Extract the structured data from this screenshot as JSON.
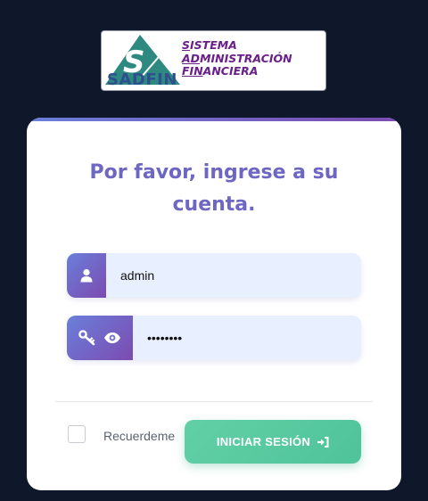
{
  "logo": {
    "name": "SADFIN",
    "lines": [
      {
        "first": "S",
        "rest": "ISTEMA"
      },
      {
        "first": "AD",
        "rest": "MINISTRACIÓN"
      },
      {
        "first": "FIN",
        "rest": "ANCIERA"
      }
    ],
    "colors": {
      "triangle": "#2e8a80",
      "text": "#6a1f8a",
      "name": "#2f4f8f"
    }
  },
  "login": {
    "title_line1": "Por favor, ingrese a su",
    "title_line2": "cuenta.",
    "username_value": "admin",
    "password_value": "••••••••",
    "remember_label": "Recuerdeme",
    "submit_label": "INICIAR SESIÓN"
  },
  "icons": {
    "user": "user-icon",
    "key": "key-icon",
    "eye": "eye-icon",
    "sign_in": "sign-in-icon"
  },
  "colors": {
    "background": "#0f172a",
    "accent": "#6e66c3",
    "button": "#5bc9a0"
  }
}
